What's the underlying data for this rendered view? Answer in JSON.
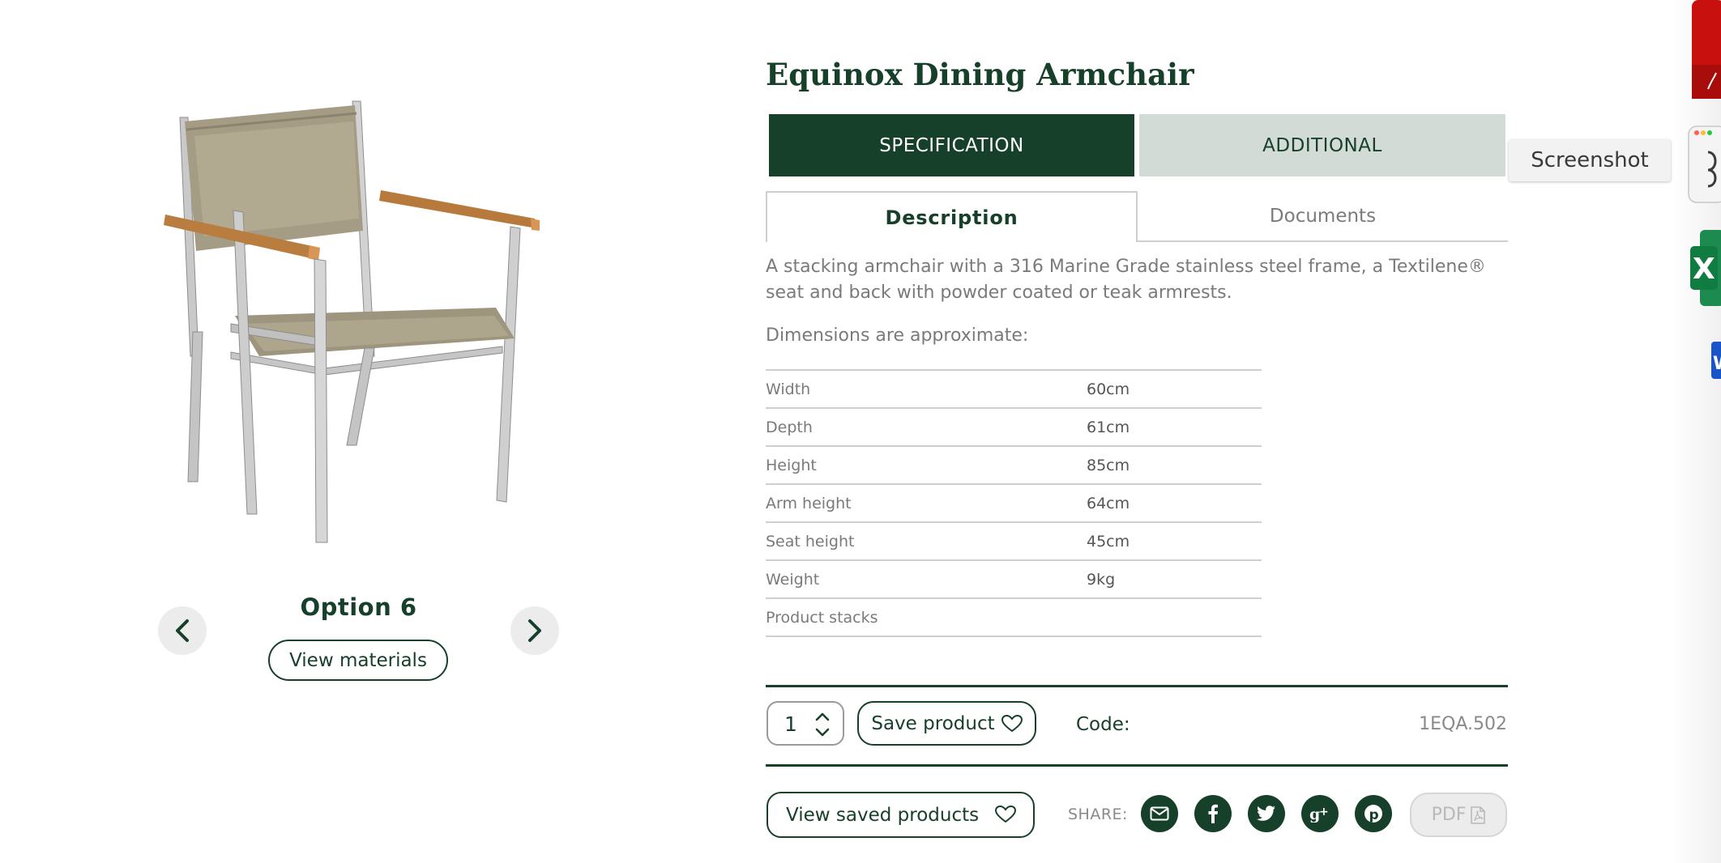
{
  "product": {
    "title": "Equinox Dining Armchair",
    "option_label": "Option 6",
    "view_materials": "View materials"
  },
  "tabs": {
    "specification": "SPECIFICATION",
    "additional": "ADDITIONAL",
    "description": "Description",
    "documents": "Documents"
  },
  "description": "A stacking armchair with a 316 Marine Grade stainless steel frame, a Textilene® seat and back with powder coated or teak armrests.",
  "dimensions_label": "Dimensions are approximate:",
  "specs": [
    {
      "key": "Width",
      "value": "60cm"
    },
    {
      "key": "Depth",
      "value": "61cm"
    },
    {
      "key": "Height",
      "value": "85cm"
    },
    {
      "key": "Arm height",
      "value": "64cm"
    },
    {
      "key": "Seat height",
      "value": "45cm"
    },
    {
      "key": "Weight",
      "value": "9kg"
    },
    {
      "key": "Product stacks",
      "value": ""
    }
  ],
  "purchase": {
    "quantity": "1",
    "save_product": "Save product",
    "code_label": "Code:",
    "code_value": "1EQA.502"
  },
  "footer": {
    "view_saved": "View saved products",
    "share_label": "SHARE:",
    "share_icons": [
      "email-icon",
      "facebook-icon",
      "twitter-icon",
      "google-plus-icon",
      "pinterest-icon"
    ],
    "pdf": "PDF"
  },
  "overlay": {
    "tooltip": "Screenshot"
  },
  "colors": {
    "brand_green": "#17402b",
    "tab_inactive": "#d3dbd6",
    "text_grey": "#7a7a7a"
  }
}
